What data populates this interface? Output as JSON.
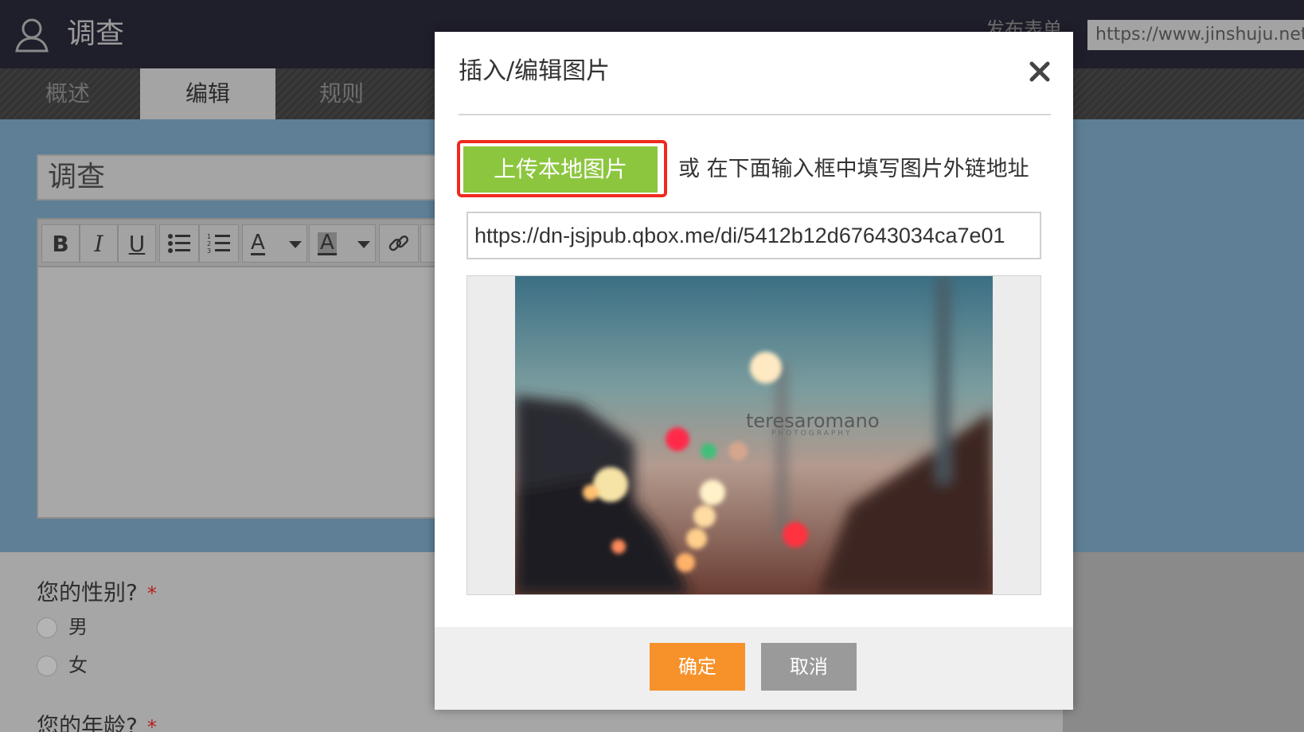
{
  "app": {
    "title": "调查",
    "header_faded_label": "发布表单",
    "url": "https://www.jinshuju.net"
  },
  "tabs": [
    {
      "label": "概述"
    },
    {
      "label": "编辑"
    },
    {
      "label": "规则"
    }
  ],
  "editor": {
    "title_value": "调查",
    "toolbar": {
      "bold": "B",
      "italic": "I",
      "underline": "U",
      "font_color_glyph": "A",
      "bg_color_glyph": "A"
    }
  },
  "form": {
    "question1": {
      "label": "您的性别?",
      "required_mark": "*",
      "options": [
        "男",
        "女"
      ]
    },
    "question2": {
      "label": "您的年龄?",
      "required_mark": "*"
    }
  },
  "modal": {
    "title": "插入/编辑图片",
    "upload_button_label": "上传本地图片",
    "upload_hint": "或 在下面输入框中填写图片外链地址",
    "image_url": "https://dn-jsjpub.qbox.me/di/5412b12d67643034ca7e01",
    "preview_watermark": "teresaromano",
    "preview_watermark_sub": "PHOTOGRAPHY",
    "ok_label": "确定",
    "cancel_label": "取消"
  },
  "colors": {
    "upload_green": "#8cc63f",
    "highlight_red": "#ee2a1f",
    "ok_orange": "#f7922b",
    "cancel_gray": "#9a9a9a"
  },
  "icons": [
    "user-icon",
    "close-icon",
    "bulleted-list-icon",
    "numbered-list-icon",
    "link-icon",
    "dropdown-caret-icon"
  ]
}
